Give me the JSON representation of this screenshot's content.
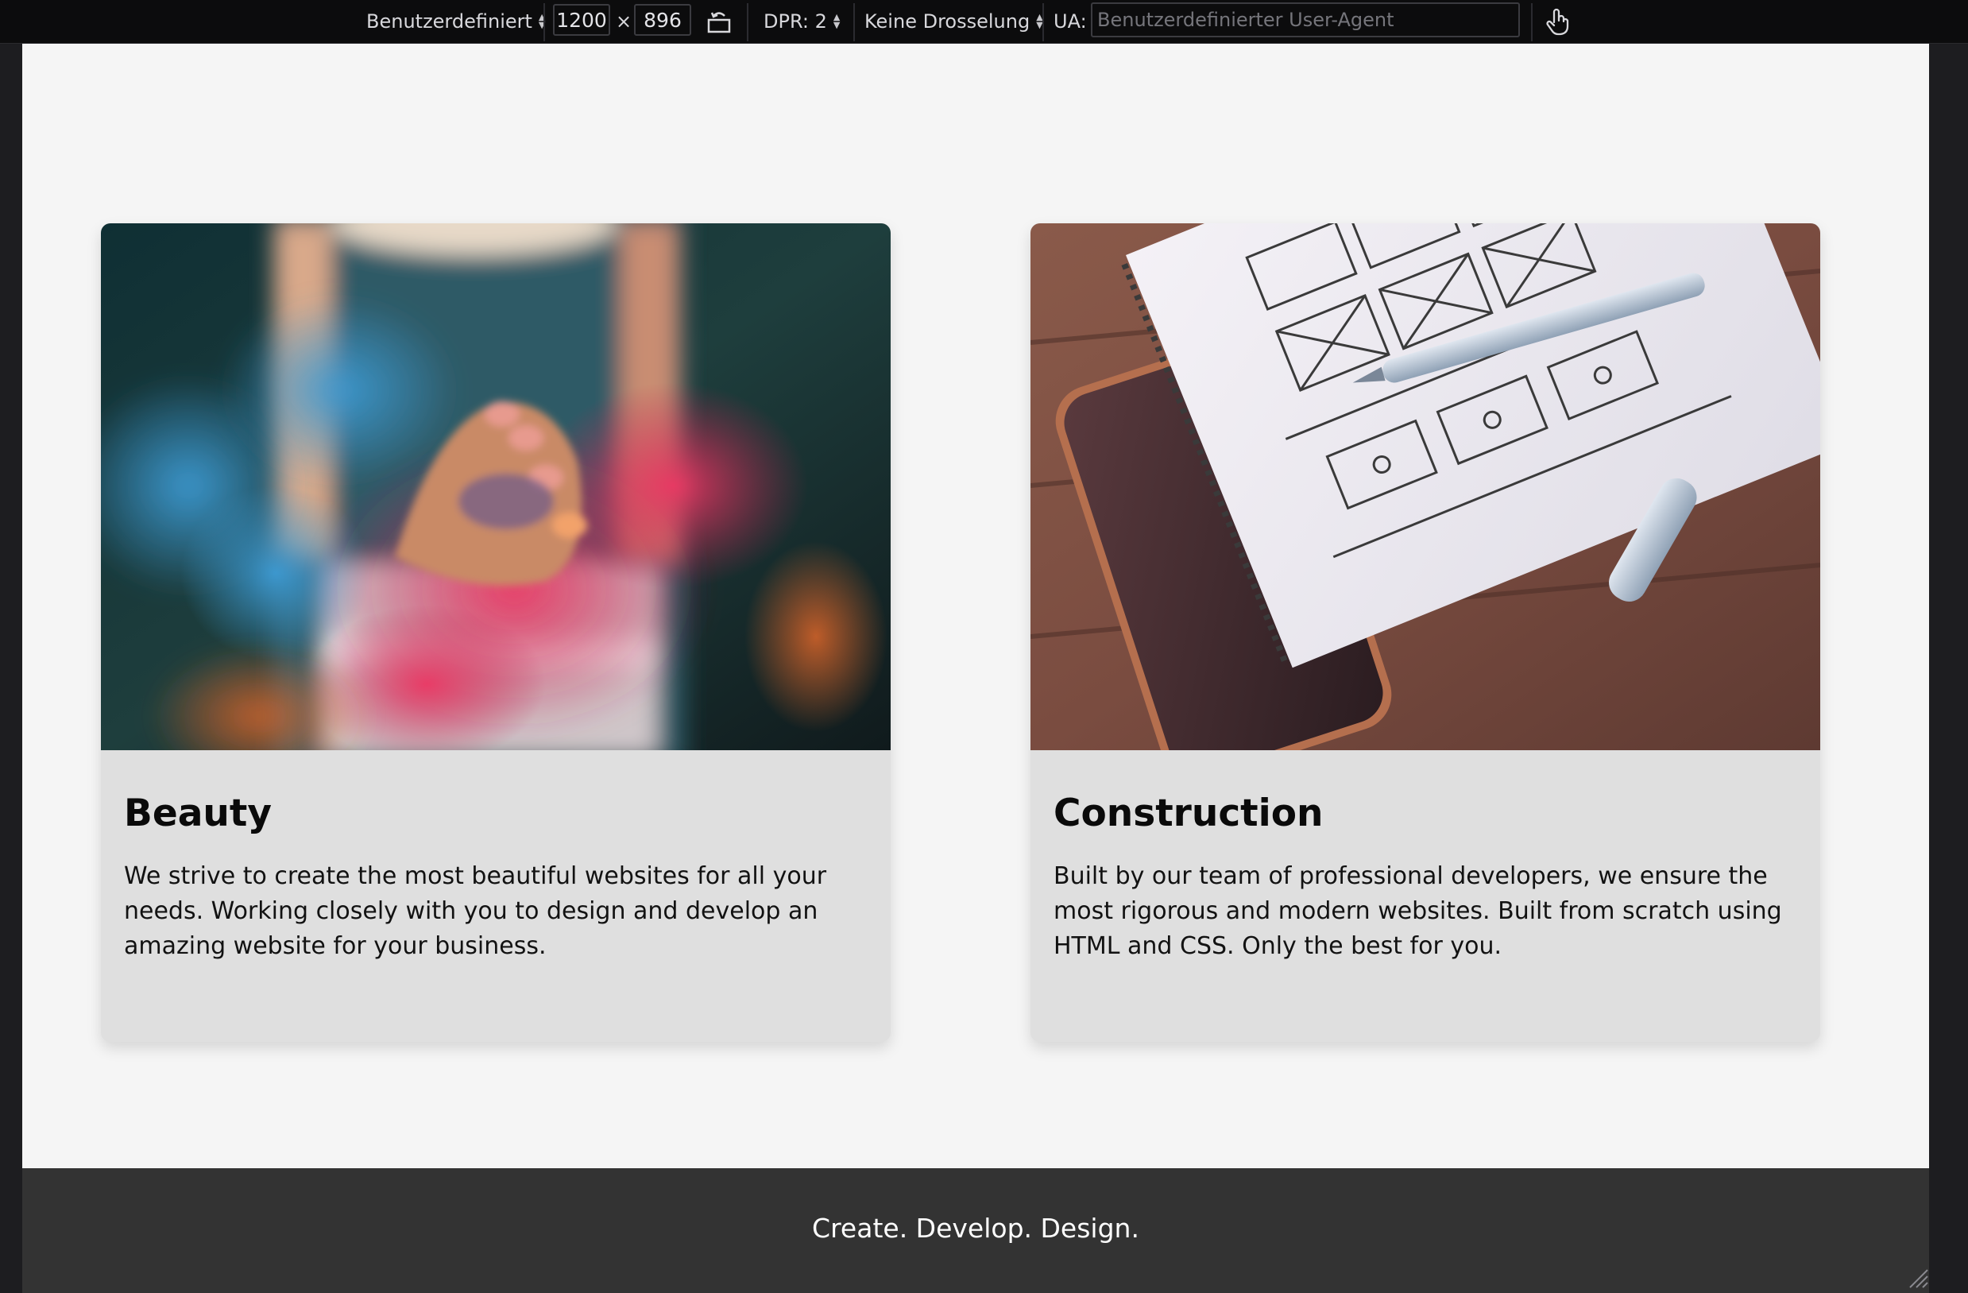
{
  "toolbar": {
    "device": "Benutzerdefiniert",
    "width": "1200",
    "times": "×",
    "height": "896",
    "dpr": "DPR: 2",
    "throttle": "Keine Drosselung",
    "ua_label": "UA:",
    "ua_placeholder": "Benutzerdefinierter User-Agent",
    "icons": [
      "rotate-icon",
      "touch-icon",
      "spinner-arrows-icon",
      "resize-handle-icon"
    ]
  },
  "page": {
    "cards": [
      {
        "title": "Beauty",
        "text": "We strive to create the most beautiful websites for all your needs. Working closely with you to design and develop an amazing website for your business.",
        "image": "colored-powder-hands-photo"
      },
      {
        "title": "Construction",
        "text": "Built by our team of professional developers, we ensure the most rigorous and modern websites. Built from scratch using HTML and CSS. Only the best for you.",
        "image": "wireframe-notebook-photo"
      }
    ],
    "footer_text": "Create. Develop. Design."
  },
  "colors": {
    "toolbar_bg": "#0c0c0d",
    "page_bg": "#f5f5f5",
    "card_bg": "#dfdfdf",
    "footer_bg": "#333333"
  }
}
